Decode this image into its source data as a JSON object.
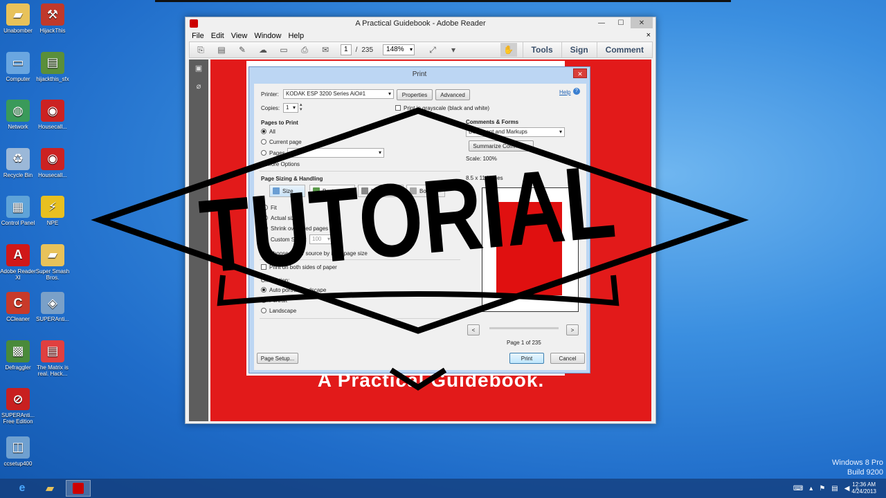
{
  "desktop": {
    "icons": [
      {
        "label": "Unabomber",
        "glyph": "folder-icon",
        "color": "#e8c25a"
      },
      {
        "label": "HijackThis",
        "glyph": "tool-icon",
        "color": "#c0392b"
      },
      {
        "label": "Computer",
        "glyph": "computer-icon",
        "color": "#6aa6e0"
      },
      {
        "label": "hijackthis_sfx",
        "glyph": "exe-icon",
        "color": "#5a8f3a"
      },
      {
        "label": "Network",
        "glyph": "network-icon",
        "color": "#3a9a5a"
      },
      {
        "label": "Housecall...",
        "glyph": "housecall-icon",
        "color": "#cc2222"
      },
      {
        "label": "Recycle Bin",
        "glyph": "recycle-bin-icon",
        "color": "#9bb8d8"
      },
      {
        "label": "Housecall...",
        "glyph": "housecall-icon",
        "color": "#cc2222"
      },
      {
        "label": "Control Panel",
        "glyph": "control-panel-icon",
        "color": "#5fa3d8"
      },
      {
        "label": "NPE",
        "glyph": "npe-icon",
        "color": "#e8c020"
      },
      {
        "label": "Adobe Reader XI",
        "glyph": "adobe-reader-icon",
        "color": "#d01818"
      },
      {
        "label": "Super Smash Bros.",
        "glyph": "folder-icon",
        "color": "#e8c25a"
      },
      {
        "label": "CCleaner",
        "glyph": "ccleaner-icon",
        "color": "#c83a2a"
      },
      {
        "label": "SUPERAnti...",
        "glyph": "superanti-icon",
        "color": "#7aa0c8"
      },
      {
        "label": "Defraggler",
        "glyph": "defraggler-icon",
        "color": "#4a8a3a"
      },
      {
        "label": "The Matrix is real. Hack...",
        "glyph": "document-icon",
        "color": "#e04040"
      },
      {
        "label": "SUPERAnti... Free Edition",
        "glyph": "superanti-free-icon",
        "color": "#c82020"
      },
      {
        "label": "ccsetup400",
        "glyph": "setup-icon",
        "color": "#6fa0d0"
      }
    ]
  },
  "window": {
    "title": "A Practical Guidebook - Adobe Reader",
    "menu": [
      "File",
      "Edit",
      "View",
      "Window",
      "Help"
    ],
    "menu_close": "×",
    "page_current": "1",
    "page_sep": "/",
    "page_total": "235",
    "zoom": "148%",
    "tools": "Tools",
    "sign": "Sign",
    "comment": "Comment",
    "doc_heading": "A Practical Guidebook."
  },
  "print_dialog": {
    "title": "Print",
    "printer_label": "Printer:",
    "printer_value": "KODAK ESP 3200 Series AiO#1",
    "properties": "Properties",
    "advanced": "Advanced",
    "help": "Help",
    "copies_label": "Copies:",
    "copies_value": "1",
    "grayscale": "Print in grayscale (black and white)",
    "pages_to_print": "Pages to Print",
    "all": "All",
    "current_page": "Current page",
    "pages": "Pages",
    "more_options": "More Options",
    "page_sizing": "Page Sizing & Handling",
    "tab_size": "Size",
    "tab_poster": "Poster",
    "tab_multiple": "Multiple",
    "tab_booklet": "Booklet",
    "fit": "Fit",
    "actual_size": "Actual size",
    "shrink": "Shrink oversized pages",
    "custom_scale": "Custom Scale:",
    "custom_scale_value": "100",
    "choose_source": "Choose paper source by PDF page size",
    "both_sides": "Print on both sides of paper",
    "orientation": "Orientation:",
    "auto_portrait": "Auto portrait/landscape",
    "portrait": "Portrait",
    "landscape": "Landscape",
    "comments_forms": "Comments & Forms",
    "comments_value": "Document and Markups",
    "summarize": "Summarize Comments",
    "scale_text": "Scale: 100%",
    "paper_size": "8.5 x 11 Inches",
    "prev": "<",
    "next": ">",
    "page_of": "Page 1 of 235",
    "page_setup": "Page Setup...",
    "print": "Print",
    "cancel": "Cancel"
  },
  "overlay": {
    "text": "TUTORIAL",
    "stroke": "#000000"
  },
  "system": {
    "winver_line1": "Windows 8 Pro",
    "winver_line2": "Build 9200",
    "time": "12:36 AM",
    "date": "4/24/2013"
  }
}
